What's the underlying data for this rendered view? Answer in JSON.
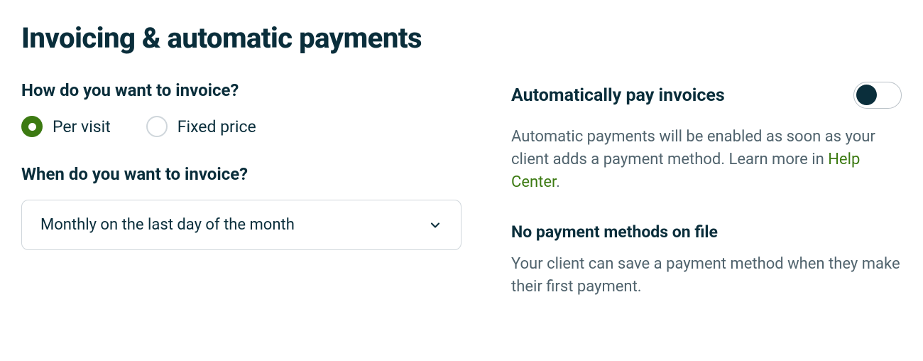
{
  "title": "Invoicing & automatic payments",
  "left": {
    "how_label": "How do you want to invoice?",
    "radio": {
      "per_visit": "Per visit",
      "fixed_price": "Fixed price",
      "selected": "per_visit"
    },
    "when_label": "When do you want to invoice?",
    "select_value": "Monthly on the last day of the month"
  },
  "right": {
    "toggle_label": "Automatically pay invoices",
    "toggle_on": false,
    "auto_text_prefix": "Automatic payments will be enabled as soon as your client adds a payment method. Learn more in ",
    "auto_link": "Help Center",
    "auto_text_suffix": ".",
    "no_methods_heading": "No payment methods on file",
    "no_methods_body": "Your client can save a payment method when they make their first payment."
  }
}
